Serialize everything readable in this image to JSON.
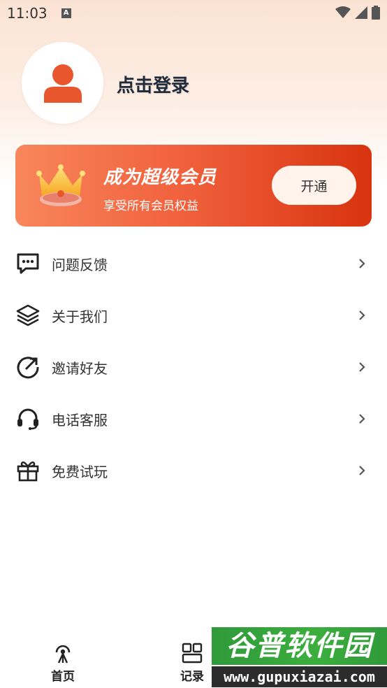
{
  "status_bar": {
    "time": "11:03",
    "notification_icon_letter": "A"
  },
  "profile": {
    "login_text": "点击登录"
  },
  "vip_card": {
    "title": "成为超级会员",
    "subtitle": "享受所有会员权益",
    "button_label": "开通",
    "accent_start": "#f8865c",
    "accent_end": "#d8330f"
  },
  "menu": {
    "items": [
      {
        "label": "问题反馈",
        "icon": "feedback-icon"
      },
      {
        "label": "关于我们",
        "icon": "layers-icon"
      },
      {
        "label": "邀请好友",
        "icon": "share-icon"
      },
      {
        "label": "电话客服",
        "icon": "headset-icon"
      },
      {
        "label": "免费试玩",
        "icon": "gift-icon"
      }
    ]
  },
  "tabbar": {
    "tabs": [
      {
        "label": "首页",
        "icon": "home-antenna-icon"
      },
      {
        "label": "记录",
        "icon": "grid-icon"
      }
    ]
  },
  "watermark": {
    "title": "谷普软件园",
    "url": "www.gupuxiazai.com"
  }
}
